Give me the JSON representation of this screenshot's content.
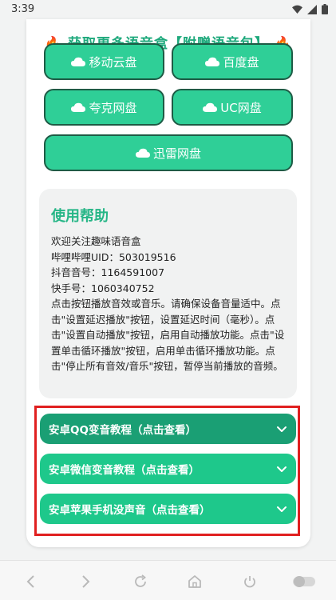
{
  "status": {
    "time": "3:39"
  },
  "header": {
    "title": "获取更多语音盒【附赠语音包】"
  },
  "drives": {
    "mobile": "移动云盘",
    "baidu": "百度盘",
    "quark": "夸克网盘",
    "uc": "UC网盘",
    "xunlei": "迅雷网盘"
  },
  "help": {
    "title": "使用帮助",
    "lines": {
      "welcome": "欢迎关注趣味语音盒",
      "bili": "哔哩哔哩UID：503019516",
      "douyin": "抖音音号：1164591007",
      "kuaishou": "快手号：1060340752",
      "instructions": "点击按钮播放音效或音乐。请确保设备音量适中。点击\"设置延迟播放\"按钮，设置延迟时间（毫秒）。点击\"设置自动播放\"按钮，启用自动播放功能。点击\"设置单击循环播放\"按钮，启用单击循环播放功能。点击\"停止所有音效/音乐\"按钮，暂停当前播放的音频。"
    }
  },
  "tutorials": {
    "qq": "安卓QQ变音教程（点击查看）",
    "wechat": "安卓微信变音教程（点击查看）",
    "apple": "安卓苹果手机没声音（点击查看）"
  },
  "icons": {
    "cloud": "cloud-icon",
    "chevron": "chevron-down-icon",
    "fire": "fire-icon"
  },
  "colors": {
    "accent": "#2fcf97",
    "accent_dark": "#1a9f74",
    "highlight": "#e02020"
  }
}
